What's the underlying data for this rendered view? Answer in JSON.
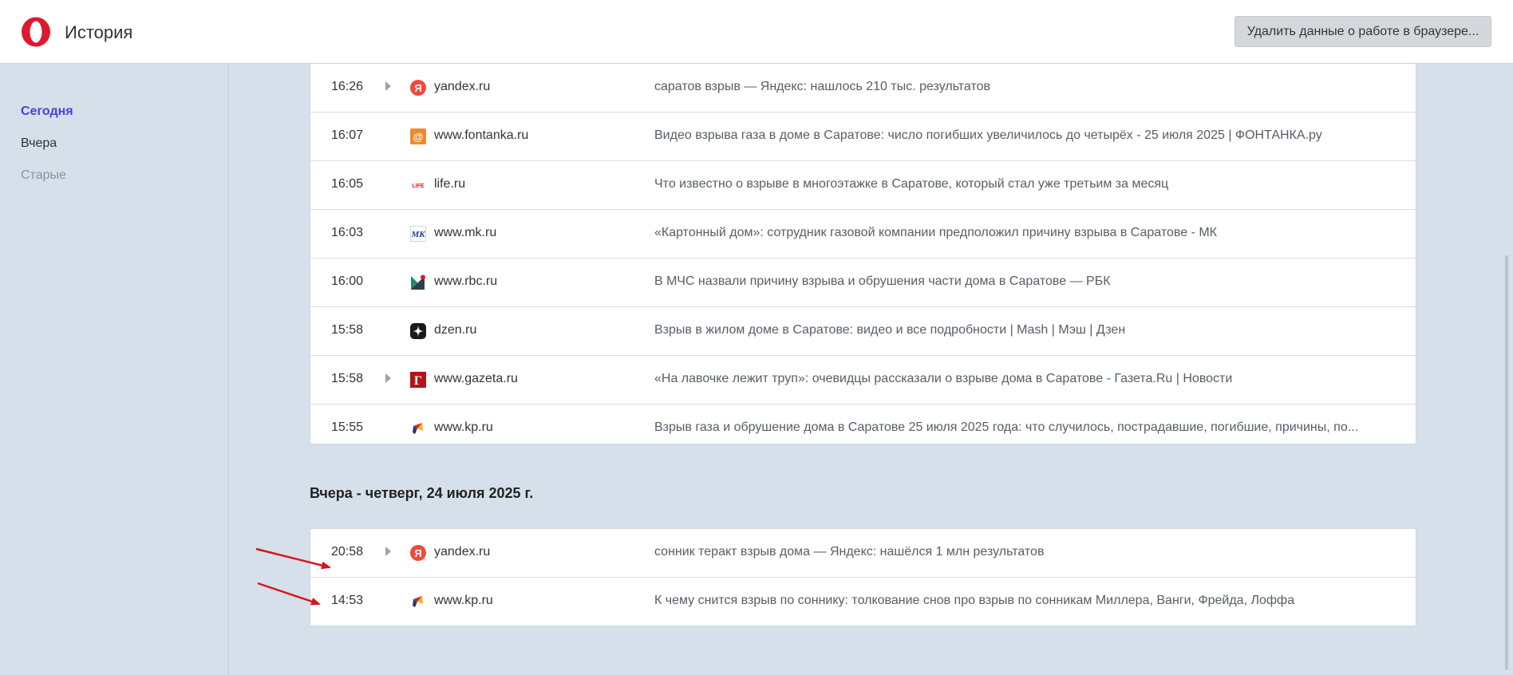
{
  "header": {
    "title": "История",
    "clear_button": "Удалить данные о работе в браузере..."
  },
  "sidebar": {
    "items": [
      {
        "label": "Сегодня",
        "state": "active"
      },
      {
        "label": "Вчера",
        "state": "normal"
      },
      {
        "label": "Старые",
        "state": "muted"
      }
    ]
  },
  "today": {
    "rows": [
      {
        "time": "16:26",
        "expandable": true,
        "favicon": "yandex-favicon-icon",
        "domain": "yandex.ru",
        "title": "саратов взрыв — Яндекс: нашлось 210 тыс. результатов"
      },
      {
        "time": "16:07",
        "expandable": false,
        "favicon": "fontanka-favicon-icon",
        "domain": "www.fontanka.ru",
        "title": "Видео взрыва газа в доме в Саратове: число погибших увеличилось до четырёх - 25 июля 2025 | ФОНТАНКА.ру"
      },
      {
        "time": "16:05",
        "expandable": false,
        "favicon": "life-favicon-icon",
        "domain": "life.ru",
        "title": "Что известно о взрыве в многоэтажке в Саратове, который стал уже третьим за месяц"
      },
      {
        "time": "16:03",
        "expandable": false,
        "favicon": "mk-favicon-icon",
        "domain": "www.mk.ru",
        "title": "«Картонный дом»: сотрудник газовой компании предположил причину взрыва в Саратове - МК"
      },
      {
        "time": "16:00",
        "expandable": false,
        "favicon": "rbc-favicon-icon",
        "domain": "www.rbc.ru",
        "title": "В МЧС назвали причину взрыва и обрушения части дома в Саратове — РБК"
      },
      {
        "time": "15:58",
        "expandable": false,
        "favicon": "dzen-favicon-icon",
        "domain": "dzen.ru",
        "title": "Взрыв в жилом доме в Саратове: видео и все подробности | Mash | Мэш | Дзен"
      },
      {
        "time": "15:58",
        "expandable": true,
        "favicon": "gazeta-favicon-icon",
        "domain": "www.gazeta.ru",
        "title": "«На лавочке лежит труп»: очевидцы рассказали о взрыве дома в Саратове - Газета.Ru | Новости"
      },
      {
        "time": "15:55",
        "expandable": false,
        "favicon": "kp-favicon-icon",
        "domain": "www.kp.ru",
        "title": "Взрыв газа и обрушение дома в Саратове 25 июля 2025 года: что случилось, пострадавшие, погибшие, причины, по..."
      }
    ]
  },
  "yesterday": {
    "heading": "Вчера - четверг, 24 июля 2025 г.",
    "rows": [
      {
        "time": "20:58",
        "expandable": true,
        "favicon": "yandex-favicon-icon",
        "domain": "yandex.ru",
        "title": "сонник теракт взрыв дома — Яндекс: нашёлся 1 млн результатов"
      },
      {
        "time": "14:53",
        "expandable": false,
        "favicon": "kp-favicon-icon",
        "domain": "www.kp.ru",
        "title": "К чему снится взрыв по соннику: толкование снов про взрыв по сонникам Миллера, Ванги, Фрейда, Лоффа"
      }
    ]
  },
  "colors": {
    "accent": "#4a3ee0",
    "opera_red": "#e0182d",
    "annotation_arrow": "#d8141c",
    "background": "#d5e0ea"
  }
}
